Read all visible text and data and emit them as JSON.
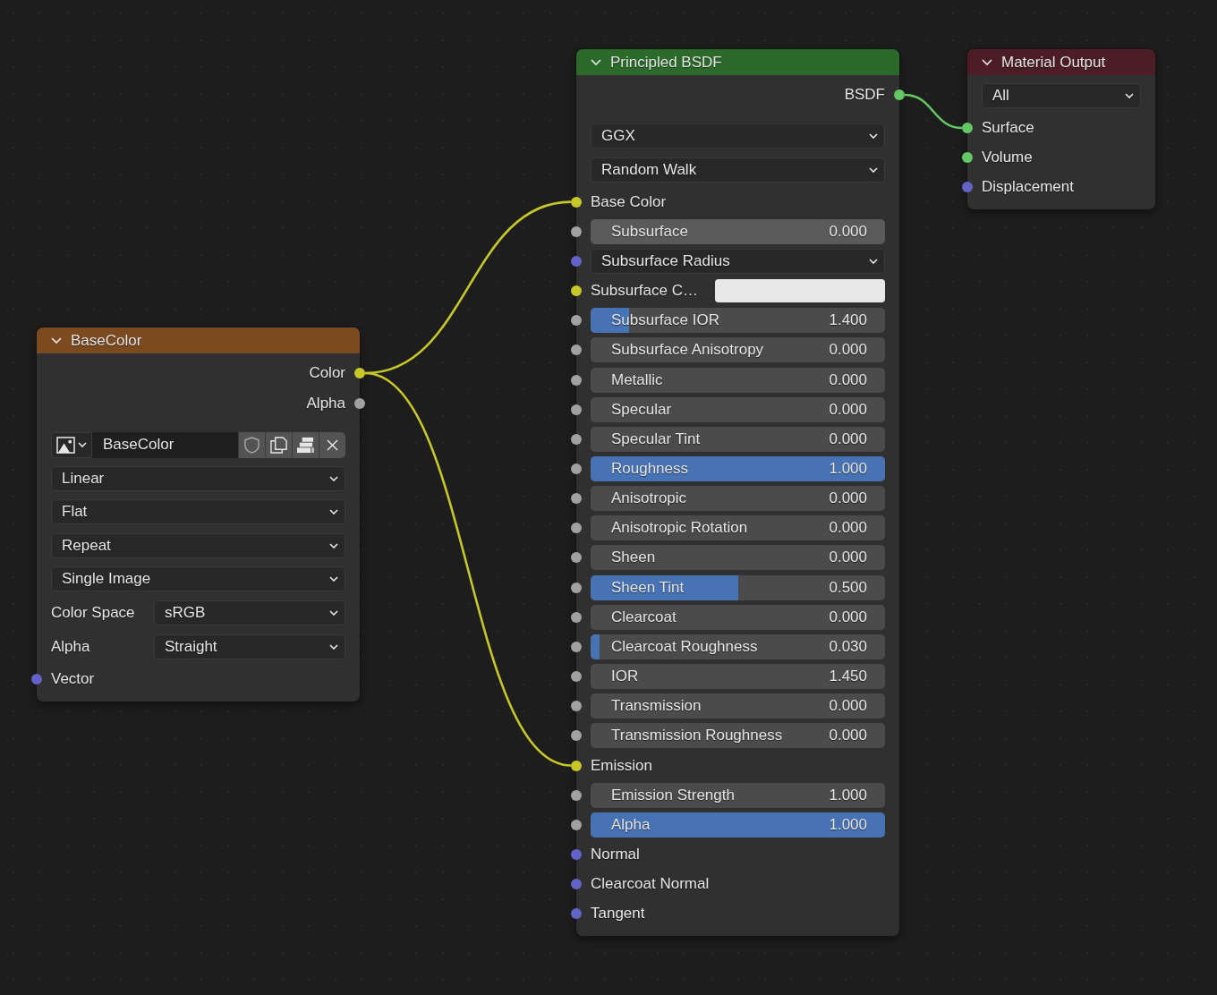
{
  "nodes": [
    {
      "title": "BaseColor",
      "color": "#7b4a1f",
      "outputs": [
        {
          "label": "Color",
          "color": "#c7c729",
          "linked": true
        },
        {
          "label": "Alpha",
          "color": "#a1a1a1",
          "linked": false
        }
      ],
      "buttons": [
        {
          "kind": "image",
          "value": "BaseColor"
        },
        {
          "kind": "dropdown",
          "value": "Linear"
        },
        {
          "kind": "dropdown",
          "value": "Flat"
        },
        {
          "kind": "dropdown",
          "value": "Repeat"
        },
        {
          "kind": "dropdown",
          "value": "Single Image"
        },
        {
          "kind": "property",
          "label": "Color Space",
          "value": "sRGB"
        },
        {
          "kind": "property",
          "label": "Alpha",
          "value": "Straight"
        }
      ],
      "inputs": [
        {
          "kind": "socket",
          "label": "Vector",
          "color": "#6363c7",
          "linked": false
        }
      ]
    },
    {
      "title": "Principled BSDF",
      "color": "#2b6a2b",
      "outputs": [
        {
          "label": "BSDF",
          "color": "#63c763",
          "linked": true
        }
      ],
      "buttons": [
        {
          "kind": "dropdown",
          "value": "GGX"
        },
        {
          "kind": "dropdown",
          "value": "Random Walk"
        }
      ],
      "inputs": [
        {
          "kind": "socket",
          "label": "Base Color",
          "color": "#c7c729",
          "linked": true
        },
        {
          "kind": "slider",
          "label": "Subsurface",
          "value": "0.000",
          "level": 0,
          "hovered": true,
          "color": "#a1a1a1",
          "linked": false
        },
        {
          "kind": "dropdown",
          "label": "Subsurface Radius",
          "color": "#6363c7",
          "linked": false
        },
        {
          "kind": "color",
          "label": "Subsurface C…",
          "swatch": {
            "color": "#e8e8e8"
          },
          "color": "#c7c729",
          "linked": false
        },
        {
          "kind": "slider",
          "label": "Subsurface IOR",
          "value": "1.400",
          "level": 0.13,
          "hovered": false,
          "color": "#a1a1a1",
          "linked": false
        },
        {
          "kind": "slider",
          "label": "Subsurface Anisotropy",
          "value": "0.000",
          "level": 0,
          "hovered": false,
          "color": "#a1a1a1",
          "linked": false
        },
        {
          "kind": "slider",
          "label": "Metallic",
          "value": "0.000",
          "level": 0,
          "hovered": false,
          "color": "#a1a1a1",
          "linked": false
        },
        {
          "kind": "slider",
          "label": "Specular",
          "value": "0.000",
          "level": 0,
          "hovered": false,
          "color": "#a1a1a1",
          "linked": false
        },
        {
          "kind": "slider",
          "label": "Specular Tint",
          "value": "0.000",
          "level": 0,
          "hovered": false,
          "color": "#a1a1a1",
          "linked": false
        },
        {
          "kind": "slider",
          "label": "Roughness",
          "value": "1.000",
          "level": 1,
          "hovered": false,
          "color": "#a1a1a1",
          "linked": false
        },
        {
          "kind": "slider",
          "label": "Anisotropic",
          "value": "0.000",
          "level": 0,
          "hovered": false,
          "color": "#a1a1a1",
          "linked": false
        },
        {
          "kind": "slider",
          "label": "Anisotropic Rotation",
          "value": "0.000",
          "level": 0,
          "hovered": false,
          "color": "#a1a1a1",
          "linked": false
        },
        {
          "kind": "slider",
          "label": "Sheen",
          "value": "0.000",
          "level": 0,
          "hovered": false,
          "color": "#a1a1a1",
          "linked": false
        },
        {
          "kind": "slider",
          "label": "Sheen Tint",
          "value": "0.500",
          "level": 0.5,
          "hovered": false,
          "color": "#a1a1a1",
          "linked": false
        },
        {
          "kind": "slider",
          "label": "Clearcoat",
          "value": "0.000",
          "level": 0,
          "hovered": false,
          "color": "#a1a1a1",
          "linked": false
        },
        {
          "kind": "slider",
          "label": "Clearcoat Roughness",
          "value": "0.030",
          "level": 0.03,
          "hovered": false,
          "color": "#a1a1a1",
          "linked": false
        },
        {
          "kind": "slider",
          "label": "IOR",
          "value": "1.450",
          "level": 0,
          "hovered": false,
          "color": "#a1a1a1",
          "linked": false
        },
        {
          "kind": "slider",
          "label": "Transmission",
          "value": "0.000",
          "level": 0,
          "hovered": false,
          "color": "#a1a1a1",
          "linked": false
        },
        {
          "kind": "slider",
          "label": "Transmission Roughness",
          "value": "0.000",
          "level": 0,
          "hovered": false,
          "color": "#a1a1a1",
          "linked": false
        },
        {
          "kind": "socket",
          "label": "Emission",
          "color": "#c7c729",
          "linked": true
        },
        {
          "kind": "slider",
          "label": "Emission Strength",
          "value": "1.000",
          "level": 0,
          "hovered": false,
          "color": "#a1a1a1",
          "linked": false
        },
        {
          "kind": "slider",
          "label": "Alpha",
          "value": "1.000",
          "level": 1,
          "hovered": false,
          "color": "#a1a1a1",
          "linked": false
        },
        {
          "kind": "socket",
          "label": "Normal",
          "color": "#6363c7",
          "linked": false
        },
        {
          "kind": "socket",
          "label": "Clearcoat Normal",
          "color": "#6363c7",
          "linked": false
        },
        {
          "kind": "socket",
          "label": "Tangent",
          "color": "#6363c7",
          "linked": false
        }
      ]
    },
    {
      "title": "Material Output",
      "color": "#4d1d26",
      "buttons": [
        {
          "kind": "dropdown",
          "value": "All"
        }
      ],
      "inputs": [
        {
          "kind": "socket",
          "label": "Surface",
          "color": "#63c763",
          "linked": true
        },
        {
          "kind": "socket",
          "label": "Volume",
          "color": "#63c763",
          "linked": false
        },
        {
          "kind": "socket",
          "label": "Displacement",
          "color": "#6363c7",
          "linked": false
        }
      ]
    }
  ]
}
